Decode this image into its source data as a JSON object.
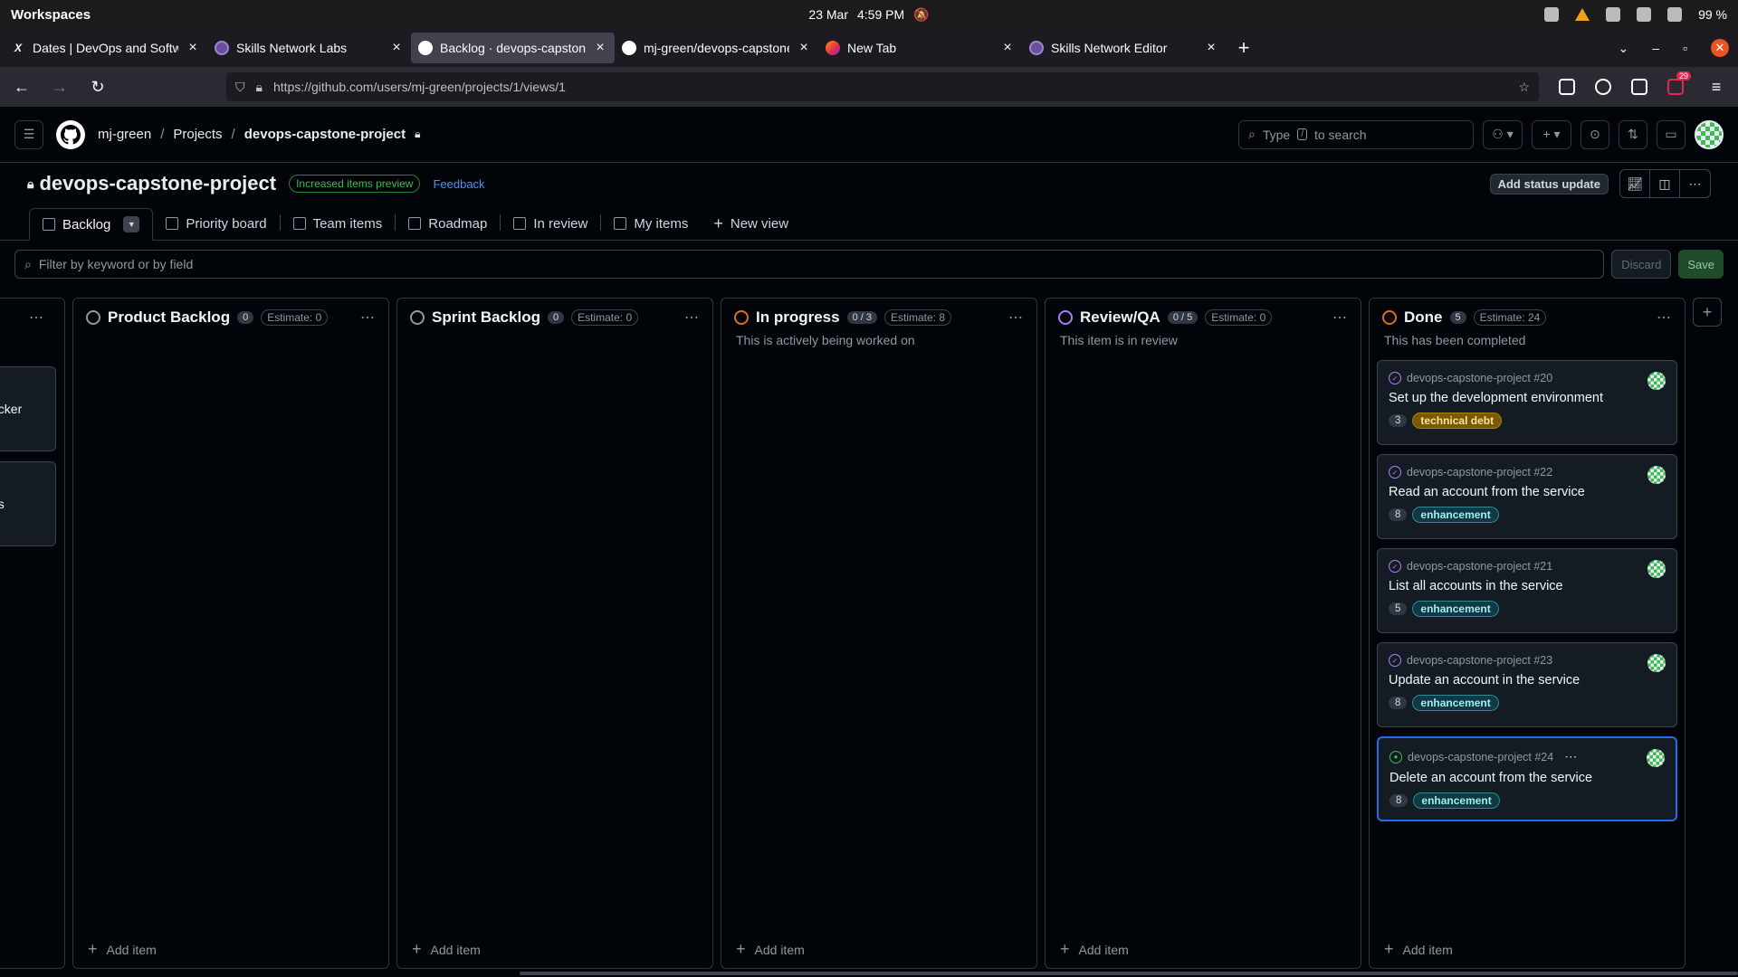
{
  "os": {
    "workspaces": "Workspaces",
    "date": "23 Mar",
    "time": "4:59 PM",
    "battery": "99 %"
  },
  "browser": {
    "tabs": [
      {
        "title": "Dates | DevOps and Softwar",
        "icon": "x-icon"
      },
      {
        "title": "Skills Network Labs",
        "icon": "skills-network-icon"
      },
      {
        "title": "Backlog · devops-capstone-",
        "icon": "github-icon"
      },
      {
        "title": "mj-green/devops-capstone",
        "icon": "github-icon"
      },
      {
        "title": "New Tab",
        "icon": "firefox-icon"
      },
      {
        "title": "Skills Network Editor",
        "icon": "skills-network-icon"
      }
    ],
    "url": "https://github.com/users/mj-green/projects/1/views/1",
    "ext_badge": "29"
  },
  "github": {
    "breadcrumbs": [
      "mj-green",
      "Projects",
      "devops-capstone-project"
    ],
    "search_placeholder_prefix": "Type",
    "search_key": "/",
    "search_placeholder_suffix": "to search"
  },
  "project": {
    "title": "devops-capstone-project",
    "preview_badge": "Increased items preview",
    "feedback": "Feedback",
    "status_button": "Add status update"
  },
  "views": [
    "Backlog",
    "Priority board",
    "Team items",
    "Roadmap",
    "In review",
    "My items",
    "New view"
  ],
  "filter": {
    "placeholder": "Filter by keyword or by field",
    "discard": "Discard",
    "save": "Save"
  },
  "partial_column": {
    "cards": [
      "ocker",
      "es"
    ]
  },
  "columns": [
    {
      "name": "Product Backlog",
      "count": "0",
      "estimate": "Estimate: 0",
      "description": "",
      "ring": "#9198a1",
      "add": "Add item",
      "cards": []
    },
    {
      "name": "Sprint Backlog",
      "count": "0",
      "estimate": "Estimate: 0",
      "description": "",
      "ring": "#9198a1",
      "add": "Add item",
      "cards": []
    },
    {
      "name": "In progress",
      "count": "0 / 3",
      "estimate": "Estimate: 8",
      "description": "This is actively being worked on",
      "ring": "#db6d28",
      "add": "Add item",
      "cards": []
    },
    {
      "name": "Review/QA",
      "count": "0 / 5",
      "estimate": "Estimate: 0",
      "description": "This item is in review",
      "ring": "#ab7df8",
      "add": "Add item",
      "cards": []
    },
    {
      "name": "Done",
      "count": "5",
      "estimate": "Estimate: 24",
      "description": "This has been completed",
      "ring": "#db6d28",
      "add": "Add item",
      "cards": [
        {
          "ref": "devops-capstone-project #20",
          "title": "Set up the development environment",
          "points": "3",
          "label": "technical debt",
          "label_kind": "td",
          "state": "closed"
        },
        {
          "ref": "devops-capstone-project #22",
          "title": "Read an account from the service",
          "points": "8",
          "label": "enhancement",
          "label_kind": "en",
          "state": "closed"
        },
        {
          "ref": "devops-capstone-project #21",
          "title": "List all accounts in the service",
          "points": "5",
          "label": "enhancement",
          "label_kind": "en",
          "state": "closed"
        },
        {
          "ref": "devops-capstone-project #23",
          "title": "Update an account in the service",
          "points": "8",
          "label": "enhancement",
          "label_kind": "en",
          "state": "closed"
        },
        {
          "ref": "devops-capstone-project #24",
          "title": "Delete an account from the service",
          "points": "8",
          "label": "enhancement",
          "label_kind": "en",
          "state": "open",
          "selected": true
        }
      ]
    }
  ]
}
